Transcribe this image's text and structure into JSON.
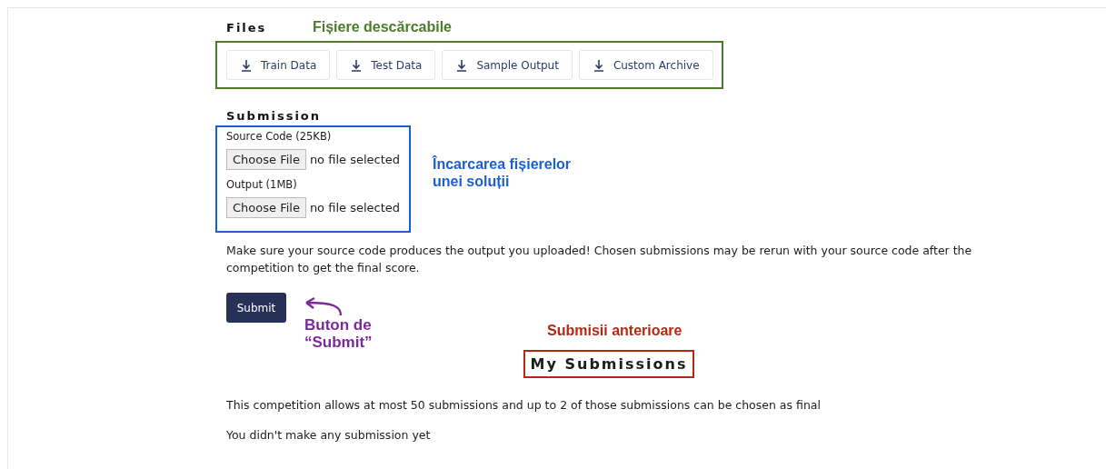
{
  "files": {
    "heading": "Files",
    "annotation": {
      "text": "Fișiere descărcabile",
      "color": "#4b7b2b"
    },
    "buttons": [
      "Train Data",
      "Test Data",
      "Sample Output",
      "Custom Archive"
    ]
  },
  "submission": {
    "heading": "Submission",
    "annotation": {
      "text": "Încarcarea fișierelor unei soluții",
      "color": "#1a5fd6"
    },
    "inputs": [
      {
        "label": "Source Code (25KB)",
        "button": "Choose File",
        "value": "no file selected"
      },
      {
        "label": "Output (1MB)",
        "button": "Choose File",
        "value": "no file selected"
      }
    ],
    "note": "Make sure your source code produces the output you uploaded! Chosen submissions may be rerun with your source code after the competition to get the final score.",
    "submit": "Submit",
    "submit_annotation": {
      "text": "Buton de “Submit”",
      "color": "#7b2a9c"
    }
  },
  "my_submissions": {
    "heading": "My Submissions",
    "annotation": {
      "text": "Submisii anterioare",
      "color": "#b82612"
    },
    "limits": "This competition allows at most 50 submissions and up to 2 of those submissions can be chosen as final",
    "empty": "You didn't make any submission yet"
  }
}
